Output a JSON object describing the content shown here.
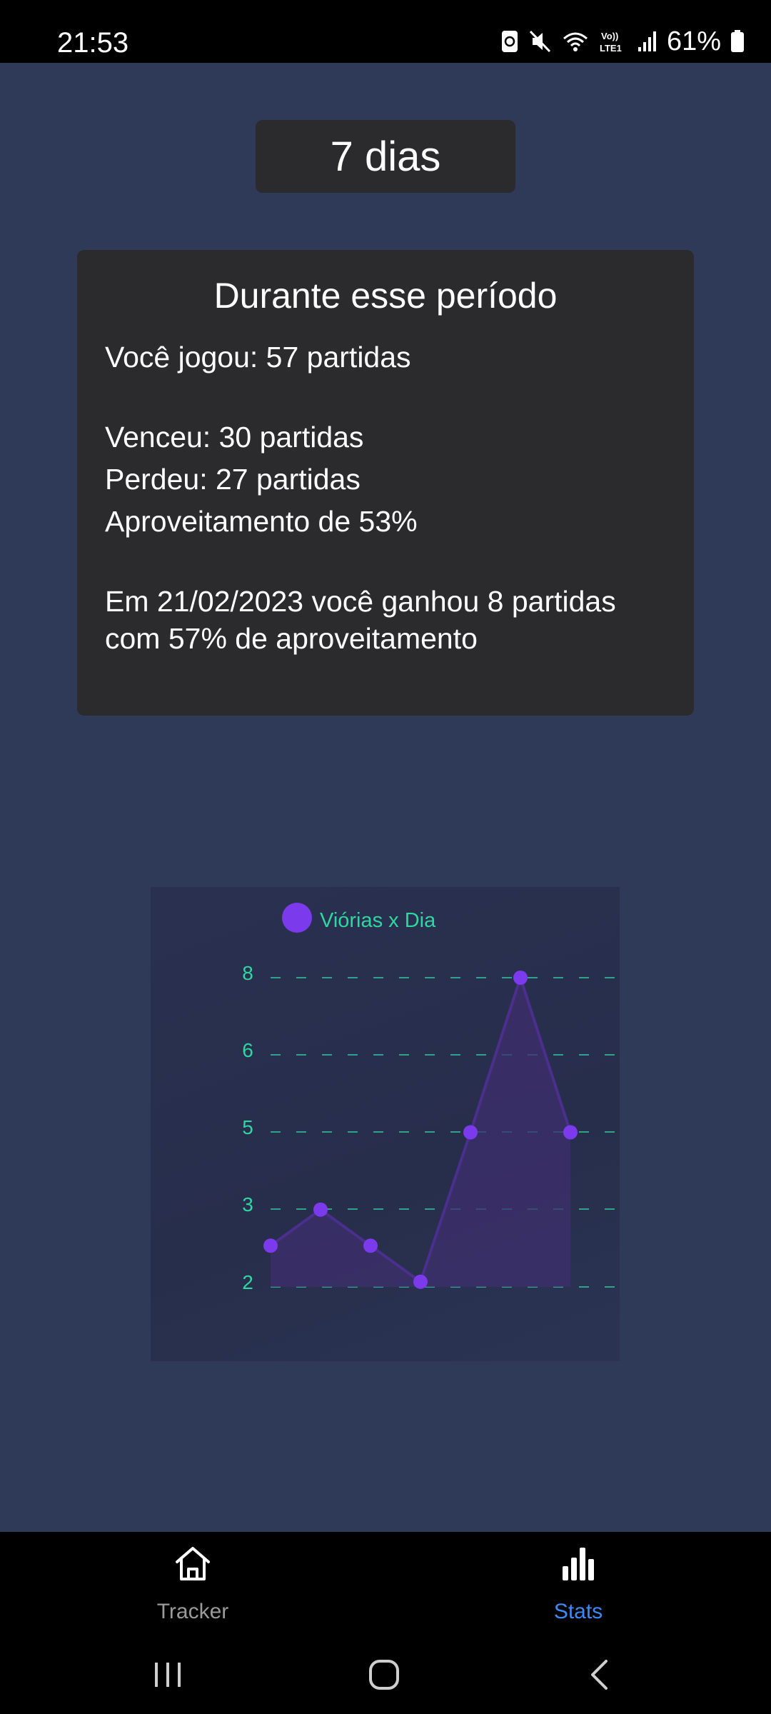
{
  "status_bar": {
    "time": "21:53",
    "battery_percent": "61%",
    "icons": [
      "sync-icon",
      "mute-icon",
      "wifi-icon",
      "volte-icon",
      "signal-icon",
      "battery-icon"
    ]
  },
  "period_selector": {
    "label": "7 dias"
  },
  "summary": {
    "title": "Durante esse período",
    "played": "Você jogou: 57 partidas",
    "won": "Venceu: 30 partidas",
    "lost": "Perdeu: 27 partidas",
    "rate": "Aproveitamento de 53%",
    "best_day_line1": "Em 21/02/2023 você ganhou 8 partidas",
    "best_day_line2": "com 57% de aproveitamento"
  },
  "chart_data": {
    "type": "area",
    "series": [
      {
        "name": "Viórias x Dia",
        "values": [
          2.8,
          3.5,
          2.8,
          2.1,
          5.0,
          8.0,
          5.0
        ]
      }
    ],
    "y_ticks": [
      "8",
      "6",
      "5",
      "3",
      "2"
    ],
    "ylim": [
      2,
      8
    ],
    "grid": true,
    "legend_position": "top",
    "colors": {
      "line": "#4a2f8c",
      "point": "#7c3aed",
      "fill": "#3d2f6e",
      "text": "#2ed6a0",
      "grid": "#2ea389"
    }
  },
  "bottom_nav": {
    "items": [
      {
        "label": "Tracker",
        "icon": "home-icon",
        "active": false
      },
      {
        "label": "Stats",
        "icon": "bar-chart-icon",
        "active": true
      }
    ],
    "colors": {
      "active": "#3d8af7",
      "inactive": "#9a9a9a"
    }
  },
  "system_nav": {
    "icons": [
      "recent-apps-icon",
      "home-circle-icon",
      "back-icon"
    ]
  }
}
